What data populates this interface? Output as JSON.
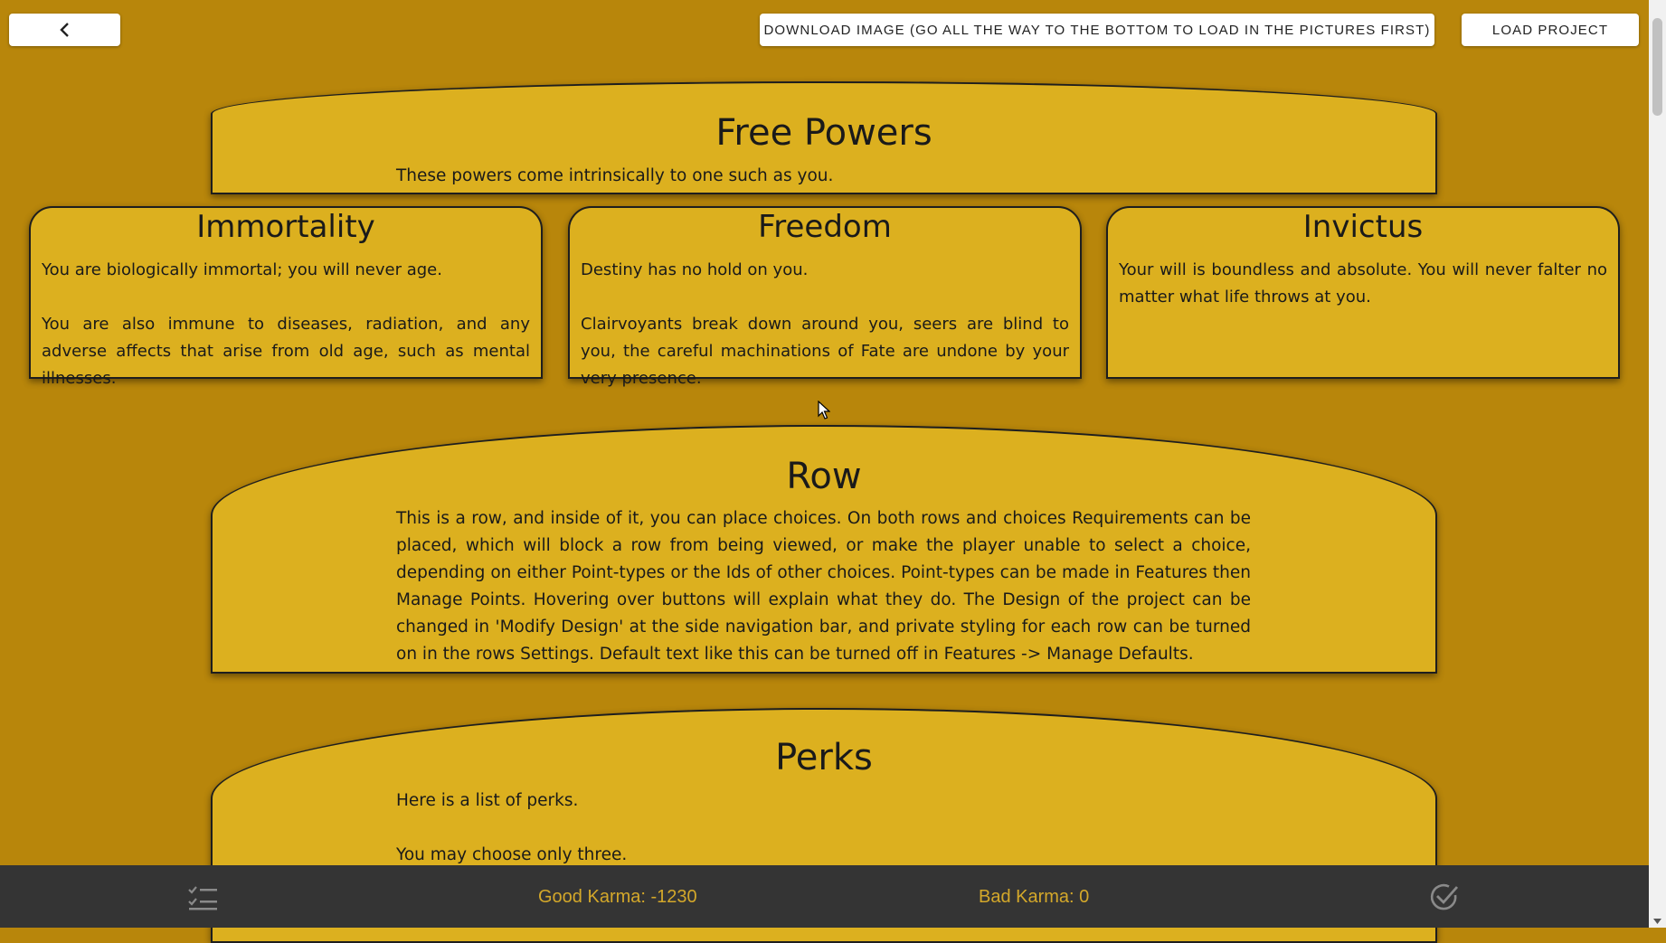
{
  "header": {
    "download_label": "DOWNLOAD IMAGE (GO ALL THE WAY TO THE BOTTOM TO LOAD IN THE PICTURES FIRST)",
    "load_label": "LOAD PROJECT",
    "back_icon": "chevron-left-icon"
  },
  "rows": {
    "free_powers": {
      "title": "Free Powers",
      "text": "These powers come intrinsically to one such as you."
    },
    "row": {
      "title": "Row",
      "text": "This is a row, and inside of it, you can place choices. On both rows and choices Requirements can be placed, which will block a row from being viewed, or make the player unable to select a choice, depending on either Point-types or the Ids of other choices. Point-types can be made in Features then Manage Points. Hovering over buttons will explain what they do. The Design of the project can be changed in 'Modify Design' at the side navigation bar, and private styling for each row can be turned on in the rows Settings. Default text like this can be turned off in Features -> Manage Defaults."
    },
    "perks": {
      "title": "Perks",
      "text_line1": "Here is a list of perks.",
      "text_line2": "You may choose only three."
    }
  },
  "choices": [
    {
      "title": "Immortality",
      "text": "You are biologically immortal; you will never age.\n\nYou are also immune to diseases, radiation, and any adverse affects that arise from old age, such as mental illnesses."
    },
    {
      "title": "Freedom",
      "text": "Destiny has no hold on you.\n\nClairvoyants break down around you, seers are blind to you, the careful machinations of Fate are undone by your very presence."
    },
    {
      "title": "Invictus",
      "text": "Your will is boundless and absolute. You will never falter no matter what life throws at you."
    }
  ],
  "footer": {
    "good_karma": "Good Karma: -1230",
    "bad_karma": "Bad Karma: 0",
    "left_icon": "checklist-icon",
    "right_icon": "check-circle-icon"
  },
  "colors": {
    "background": "#b8860b",
    "card": "#dcb01f",
    "footer": "#343434",
    "karma_text": "#d4a82a"
  }
}
